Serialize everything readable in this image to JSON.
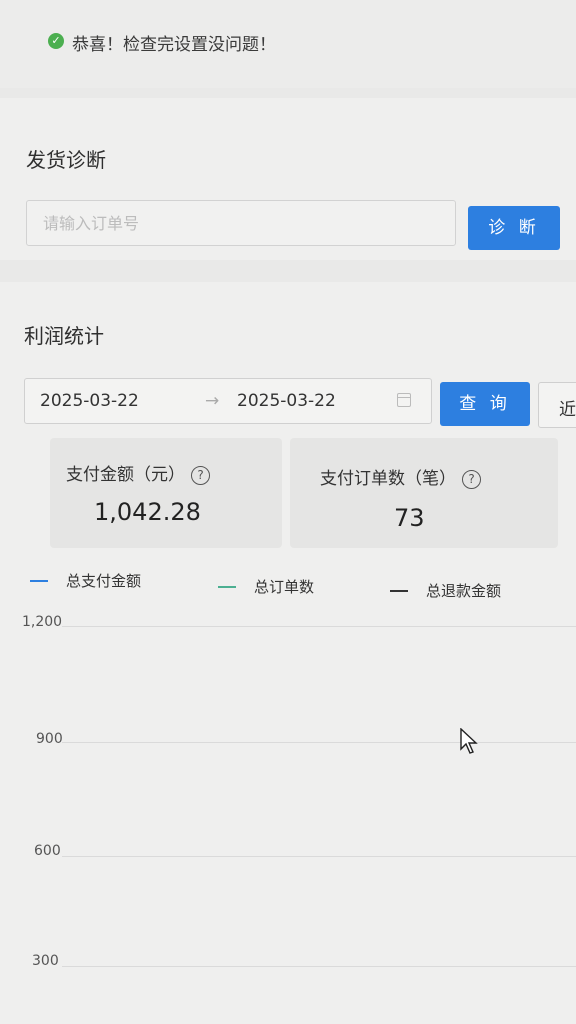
{
  "notice": {
    "text": "恭喜！检查完设置没问题！"
  },
  "diagnosis": {
    "title": "发货诊断",
    "order_placeholder": "请输入订单号",
    "button_label": "诊 断"
  },
  "profit": {
    "title": "利润统计",
    "date_from": "2025-03-22",
    "date_to": "2025-03-22",
    "arrow": "→",
    "query_button": "查 询",
    "recent_button": "近",
    "cards": [
      {
        "label": "支付金额（元）",
        "value": "1,042.28"
      },
      {
        "label": "支付订单数（笔）",
        "value": "73"
      }
    ]
  },
  "chart_data": {
    "type": "line",
    "legend": [
      "总支付金额",
      "总订单数",
      "总退款金额"
    ],
    "y_ticks": [
      "1,200",
      "900",
      "600",
      "300"
    ],
    "ylim": [
      0,
      1200
    ],
    "series_colors": [
      "#2d7fe0",
      "#4caf91",
      "#333333"
    ]
  }
}
